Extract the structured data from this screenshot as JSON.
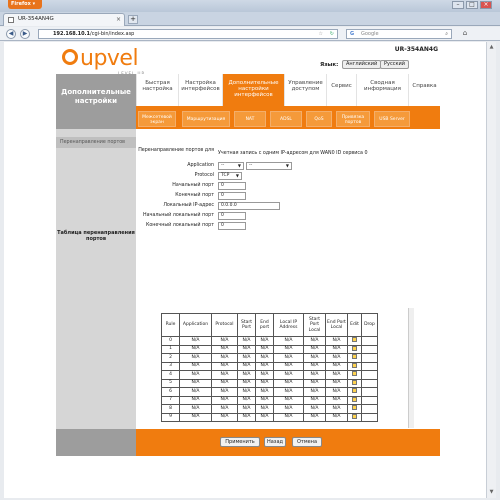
{
  "browser": {
    "app_button": "Firefox ▾",
    "tab_title": "UR-354AN4G",
    "url_host": "192.168.10.1",
    "url_path": "/cgi-bin/index.asp",
    "search_engine": "Google"
  },
  "header": {
    "model": "UR-354AN4G",
    "logo_word": "upvel",
    "logo_tag": "LEVEL UP",
    "language_label": "Язык:",
    "lang_english": "Английский",
    "lang_russian": "Русский"
  },
  "sidebar": {
    "title": "Дополнительные настройки",
    "section_title": "Перенаправление портов",
    "table_title": "Таблица перенаправления портов"
  },
  "menu": {
    "tabs": [
      "Быстрая настройка",
      "Настройка интерфейсов",
      "Дополнительные настройки интерфейсов",
      "Управление доступом",
      "Сервис",
      "Сводная информация",
      "Справка"
    ],
    "subtabs": [
      "Межсетевой экран",
      "Маршрутизация",
      "NAT",
      "ADSL",
      "QoS",
      "Привязка портов",
      "USB Server"
    ]
  },
  "form": {
    "label_redirect": "Перенаправление портов для",
    "value_redirect": "Учетная запись с одним IP-адресом для WAN0 ID сервиса 0",
    "label_application": "Application",
    "app_select1": "--",
    "app_select2": "--",
    "label_protocol": "Protocol",
    "protocol_value": "TCP",
    "label_start_port": "Начальный порт",
    "start_port": "0",
    "label_end_port": "Конечный порт",
    "end_port": "0",
    "label_local_ip": "Локальный IP-адрес",
    "local_ip": "0.0.0.0",
    "label_start_local": "Начальный локальный порт",
    "start_local": "0",
    "label_end_local": "Конечный локальный порт",
    "end_local": "0"
  },
  "table": {
    "headers": [
      "Rule",
      "Application",
      "Protocol",
      "Start Port",
      "End port",
      "Local IP Address",
      "Start Port Local",
      "End Port Local",
      "Edit",
      "Drop"
    ],
    "rows": [
      [
        "0",
        "N/A",
        "N/A",
        "N/A",
        "N/A",
        "N/A",
        "N/A",
        "N/A"
      ],
      [
        "1",
        "N/A",
        "N/A",
        "N/A",
        "N/A",
        "N/A",
        "N/A",
        "N/A"
      ],
      [
        "2",
        "N/A",
        "N/A",
        "N/A",
        "N/A",
        "N/A",
        "N/A",
        "N/A"
      ],
      [
        "3",
        "N/A",
        "N/A",
        "N/A",
        "N/A",
        "N/A",
        "N/A",
        "N/A"
      ],
      [
        "4",
        "N/A",
        "N/A",
        "N/A",
        "N/A",
        "N/A",
        "N/A",
        "N/A"
      ],
      [
        "5",
        "N/A",
        "N/A",
        "N/A",
        "N/A",
        "N/A",
        "N/A",
        "N/A"
      ],
      [
        "6",
        "N/A",
        "N/A",
        "N/A",
        "N/A",
        "N/A",
        "N/A",
        "N/A"
      ],
      [
        "7",
        "N/A",
        "N/A",
        "N/A",
        "N/A",
        "N/A",
        "N/A",
        "N/A"
      ],
      [
        "8",
        "N/A",
        "N/A",
        "N/A",
        "N/A",
        "N/A",
        "N/A",
        "N/A"
      ],
      [
        "9",
        "N/A",
        "N/A",
        "N/A",
        "N/A",
        "N/A",
        "N/A",
        "N/A"
      ]
    ]
  },
  "buttons": {
    "apply": "Применить",
    "back": "Назад",
    "cancel": "Отмена"
  },
  "icons": {
    "edit": "edit-icon",
    "back": "arrow-left-icon",
    "forward": "arrow-right-icon",
    "home": "home-icon",
    "search": "search-icon"
  },
  "colors": {
    "brand_orange": "#f07c0f",
    "sidebar_gray": "#9d9d9d"
  }
}
